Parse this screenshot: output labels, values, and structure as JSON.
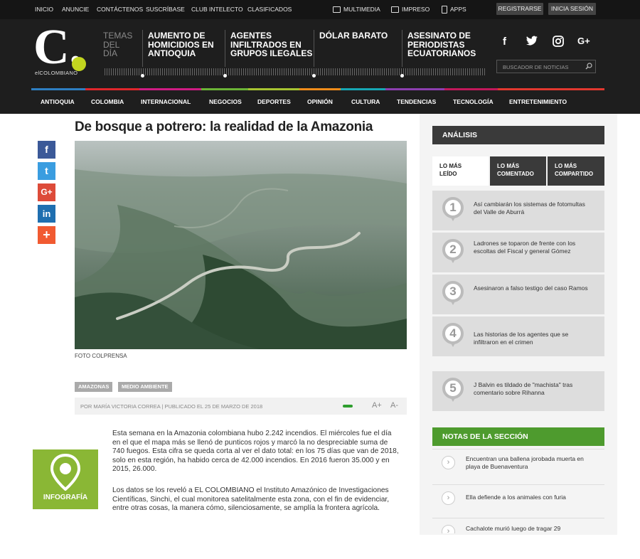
{
  "topbar": {
    "links": [
      "INICIO",
      "ANUNCIE",
      "CONTÁCTENOS",
      "SUSCRÍBASE",
      "CLUB INTELECTO",
      "CLASIFICADOS"
    ],
    "multimedia": "MULTIMEDIA",
    "impreso": "IMPRESO",
    "apps": "APPS",
    "register": "REGISTRARSE",
    "login": "INICIA SESIÓN"
  },
  "logo": {
    "letter": "C.",
    "name": "elCOLOMBIANO"
  },
  "temas": [
    "TEMAS",
    "DEL",
    "DÍA"
  ],
  "headlines": [
    [
      "AUMENTO DE",
      "HOMICIDIOS EN",
      "ANTIOQUIA"
    ],
    [
      "AGENTES",
      "INFILTRADOS EN",
      "GRUPOS ILEGALES"
    ],
    [
      "DÓLAR BARATO"
    ],
    [
      "ASESINATO DE",
      "PERIODISTAS",
      "ECUATORIANOS"
    ]
  ],
  "social_icons": [
    "facebook-icon",
    "twitter-icon",
    "instagram-icon",
    "google-plus-icon"
  ],
  "search": {
    "placeholder": "BUSCADOR DE NOTICIAS"
  },
  "nav": [
    {
      "label": "ANTIOQUIA",
      "color": "#2e7fc2"
    },
    {
      "label": "COLOMBIA",
      "color": "#e0262c"
    },
    {
      "label": "INTERNACIONAL",
      "color": "#cf1c84"
    },
    {
      "label": "NEGOCIOS",
      "color": "#6bb436"
    },
    {
      "label": "DEPORTES",
      "color": "#a7c431"
    },
    {
      "label": "OPINIÓN",
      "color": "#f08c1a"
    },
    {
      "label": "CULTURA",
      "color": "#17a7b4"
    },
    {
      "label": "TENDENCIAS",
      "color": "#8c3fb0"
    },
    {
      "label": "TECNOLOGÍA",
      "color": "#c2185b"
    },
    {
      "label": "ENTRETENIMIENTO",
      "color": "#e2382f"
    }
  ],
  "article": {
    "title": "De bosque a potrero: la realidad de la Amazonia",
    "photo_credit": "FOTO COLPRENSA",
    "tags": [
      "AMAZONAS",
      "MEDIO AMBIENTE"
    ],
    "byline": "POR MARÍA VICTORIA CORREA | PUBLICADO EL 25 DE MARZO DE 2018",
    "font_up": "A+",
    "font_down": "A-",
    "infographic_label": "INFOGRAFÍA",
    "paragraphs": [
      "Esta semana en la Amazonia colombiana hubo 2.242 incendios. El miércoles fue el día en el que el mapa más se llenó de punticos rojos y marcó la no despreciable suma de 740 fuegos. Esta cifra se queda corta al ver el dato total: en los 75 días que van de 2018, solo en esta región, ha habido cerca de 42.000 incendios. En 2016 fueron 35.000 y en 2015, 26.000.",
      "Los datos se los reveló a EL COLOMBIANO el Instituto Amazónico de Investigaciones Científicas, Sinchi, el cual monitorea satelitalmente esta zona, con el fin de evidenciar, entre otras cosas, la manera cómo, silenciosamente, se amplía la frontera agrícola."
    ]
  },
  "share_buttons": [
    {
      "name": "facebook-share-button",
      "glyph": "f",
      "color": "#3b5998"
    },
    {
      "name": "twitter-share-button",
      "glyph": "t",
      "color": "#3a9de0"
    },
    {
      "name": "google-plus-share-button",
      "glyph": "G+",
      "color": "#dd4b39"
    },
    {
      "name": "linkedin-share-button",
      "glyph": "in",
      "color": "#1f6fb0"
    },
    {
      "name": "more-share-button",
      "glyph": "+",
      "color": "#f15a31"
    }
  ],
  "sidebar": {
    "analysis_title": "ANÁLISIS",
    "tabs": [
      [
        "LO MÁS",
        "LEÍDO"
      ],
      [
        "LO MÁS",
        "COMENTADO"
      ],
      [
        "LO MÁS",
        "COMPARTIDO"
      ]
    ],
    "most_read": [
      {
        "n": "1",
        "text": "Así cambiarán los sistemas de fotomultas del Valle de Aburrá"
      },
      {
        "n": "2",
        "text": "Ladrones se toparon de frente con los escoltas del Fiscal y general Gómez"
      },
      {
        "n": "3",
        "text": "Asesinaron a falso testigo del caso Ramos"
      },
      {
        "n": "4",
        "text": "Las historias de los agentes que se infiltraron en el crimen"
      },
      {
        "n": "5",
        "text": "J Balvin es tildado de \"machista\" tras comentario sobre Rihanna"
      }
    ],
    "notes_title": "NOTAS DE LA SECCIÓN",
    "notes": [
      "Encuentran una ballena jorobada muerta en playa de Buenaventura",
      "Ella defiende a los animales con furia",
      "Cachalote murió luego de tragar 29"
    ]
  }
}
